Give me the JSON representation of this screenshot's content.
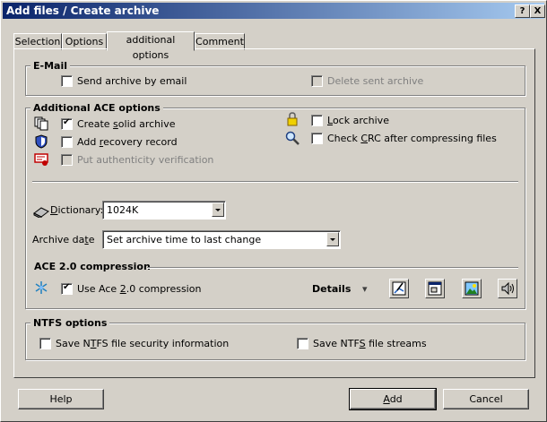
{
  "window": {
    "title": "Add files / Create archive",
    "help_btn": "?",
    "close_btn": "X"
  },
  "tabs": [
    {
      "label": "Selection",
      "active": false
    },
    {
      "label": "Options",
      "active": false
    },
    {
      "label": "additional options",
      "active": true
    },
    {
      "label": "Comment",
      "active": false
    }
  ],
  "email": {
    "title": "E-Mail",
    "send": {
      "label": "Send archive by email",
      "checked": false
    },
    "delete": {
      "label": "Delete sent archive",
      "checked": false,
      "disabled": true
    }
  },
  "ace": {
    "title": "Additional ACE options",
    "solid": {
      "label": "Create solid archive",
      "checked": true
    },
    "recovery": {
      "label": "Add recovery record",
      "checked": false
    },
    "authenticity": {
      "label": "Put authenticity verification",
      "checked": false,
      "disabled": true
    },
    "lock": {
      "label": "Lock archive",
      "checked": false
    },
    "crc": {
      "label": "Check CRC after compressing files",
      "checked": false
    },
    "dictionary_label": "Dictionary:",
    "dictionary_value": "1024K",
    "date_label": "Archive date",
    "date_value": "Set archive time to last change",
    "ace2_title": "ACE 2.0 compression",
    "ace2": {
      "label": "Use Ace 2.0 compression",
      "checked": true
    },
    "details_label": "Details",
    "details_arrow": "▾"
  },
  "ntfs": {
    "title": "NTFS options",
    "security": {
      "label": "Save NTFS file security information",
      "checked": false
    },
    "streams": {
      "label": "Save NTFS file streams",
      "checked": false
    }
  },
  "buttons": {
    "help": "Help",
    "add": "Add",
    "cancel": "Cancel"
  },
  "icons": {
    "solid": "stacked-pages-icon",
    "recovery": "shield-icon",
    "authenticity": "certificate-icon",
    "lock": "padlock-icon",
    "crc": "magnifier-icon",
    "dictionary": "book-icon",
    "ace2": "snowflake-icon",
    "detail_buttons": [
      "graphics-compression-icon",
      "exe-compression-icon",
      "picture-compression-icon",
      "sound-compression-icon"
    ]
  }
}
